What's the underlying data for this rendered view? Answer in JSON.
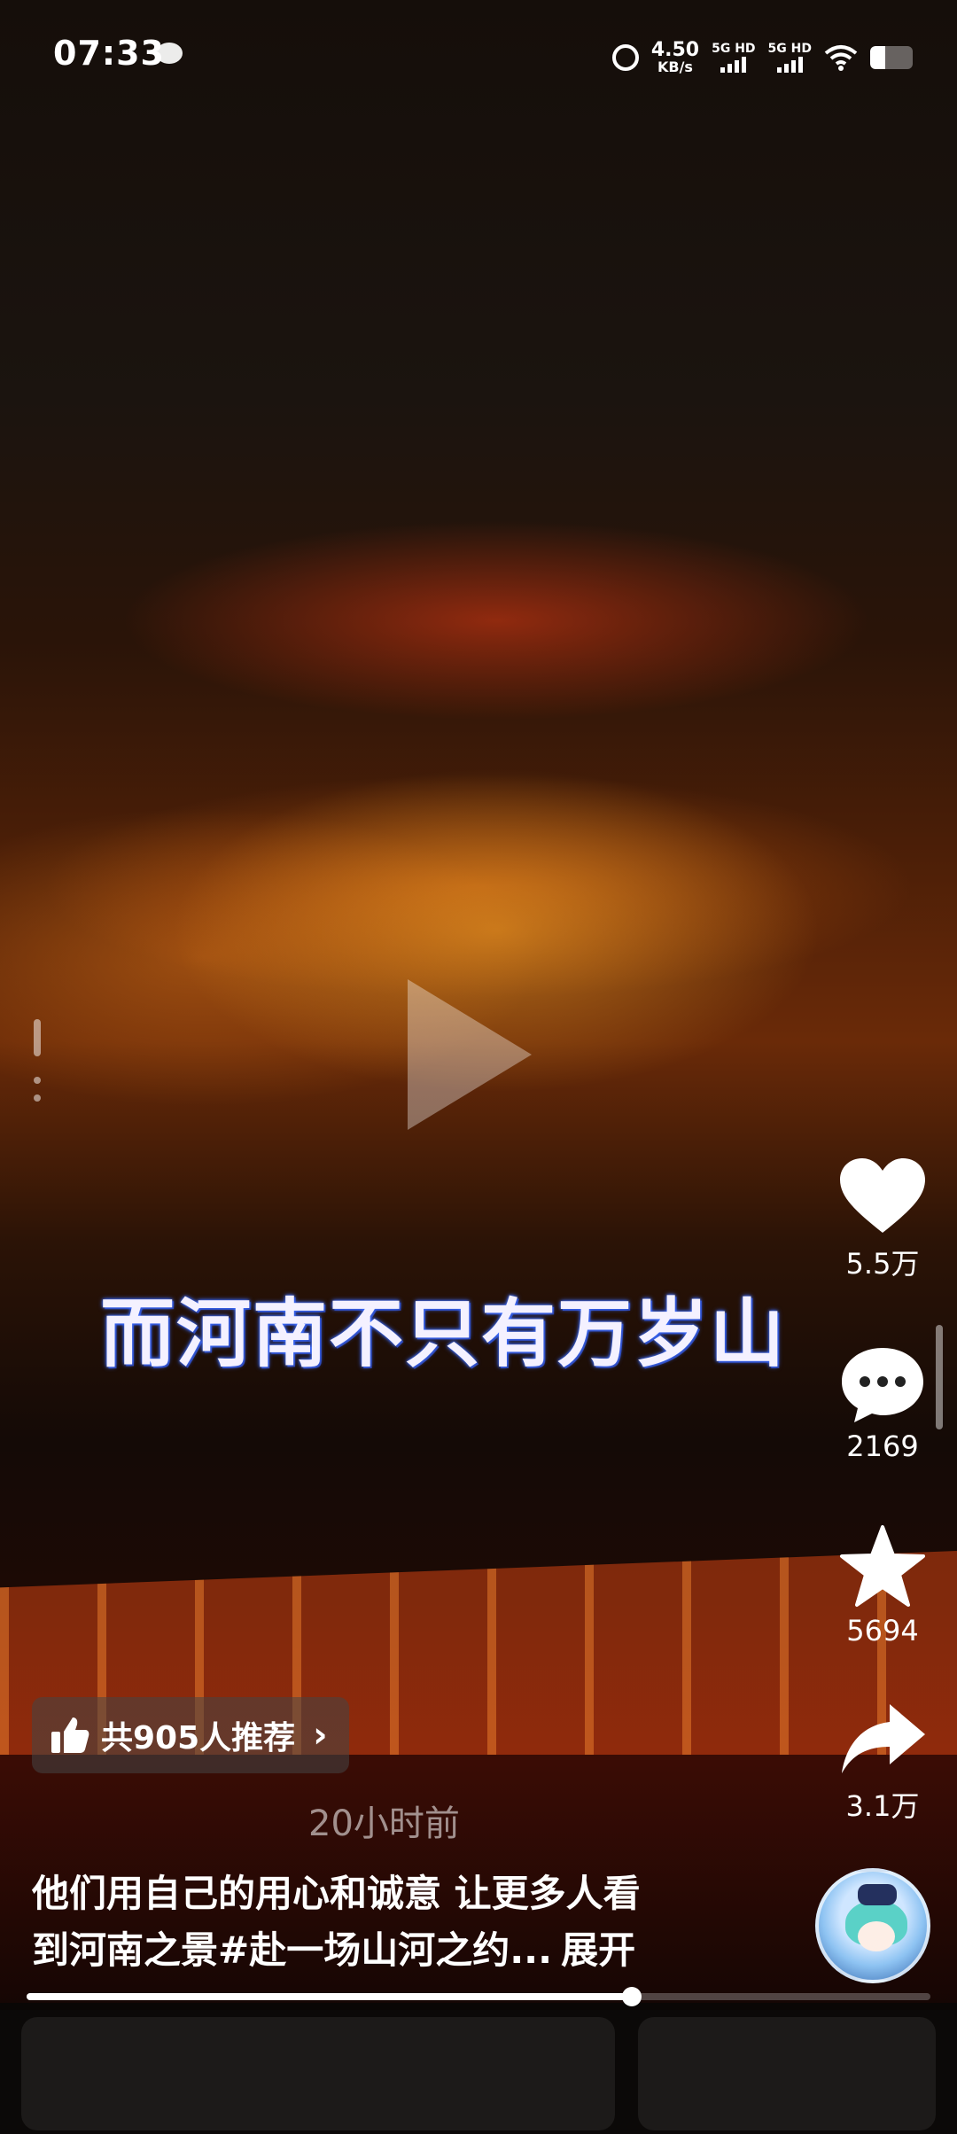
{
  "status_bar": {
    "time": "07:33",
    "speed_value": "4.50",
    "speed_unit": "KB/s",
    "signal1_label": "5G HD",
    "signal2_label": "5G HD",
    "battery_level": 0.35
  },
  "video": {
    "caption": "而河南不只有万岁山",
    "progress": 0.67
  },
  "actions": {
    "likes": "5.5万",
    "comments": "2169",
    "favorites": "5694",
    "shares": "3.1万"
  },
  "recommend": {
    "label": "共905人推荐"
  },
  "post": {
    "timestamp": "20小时前",
    "description_line1": "他们用自己的用心和诚意 让更多人看",
    "description_line2": "到河南之景#赴一场山河之约...",
    "expand_label": "展开"
  }
}
